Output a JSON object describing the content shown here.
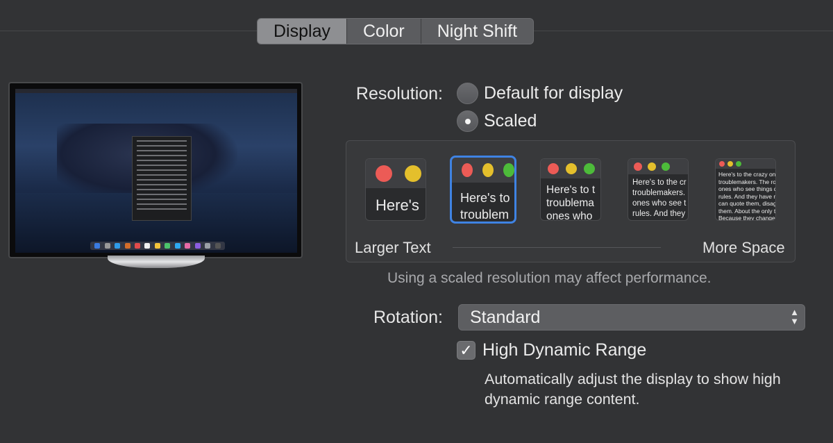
{
  "tabs": [
    {
      "label": "Display",
      "active": true
    },
    {
      "label": "Color",
      "active": false
    },
    {
      "label": "Night Shift",
      "active": false
    }
  ],
  "resolution": {
    "label": "Resolution:",
    "options": [
      {
        "label": "Default for display",
        "checked": false
      },
      {
        "label": "Scaled",
        "checked": true
      }
    ]
  },
  "scaled": {
    "previews": [
      {
        "text": "Here's",
        "selected": false
      },
      {
        "text": "Here's to\ntroublem",
        "selected": true
      },
      {
        "text": "Here's to t\ntroublema\nones who",
        "selected": false
      },
      {
        "text": "Here's to the cr\ntroublemakers.\nones who see t\nrules. And they",
        "selected": false
      },
      {
        "text": "Here's to the crazy ones\ntroublemakers. The rou\nones who see things dif\nrules. And they have no\ncan quote them, disagr\nthem. About the only th\nBecause they change t",
        "selected": false
      }
    ],
    "left_label": "Larger Text",
    "right_label": "More Space",
    "note": "Using a scaled resolution may affect performance."
  },
  "rotation": {
    "label": "Rotation:",
    "value": "Standard"
  },
  "hdr": {
    "label": "High Dynamic Range",
    "checked": true,
    "description": "Automatically adjust the display to show high dynamic range content."
  },
  "colors": {
    "accent": "#3f83e3",
    "background": "#323335",
    "traffic_red": "#ec5b56",
    "traffic_yellow": "#e4bf2c",
    "traffic_green": "#4dbb3a"
  }
}
